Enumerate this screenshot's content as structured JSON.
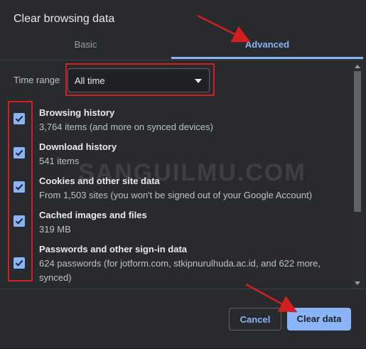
{
  "dialog": {
    "title": "Clear browsing data"
  },
  "tabs": [
    {
      "label": "Basic",
      "active": false
    },
    {
      "label": "Advanced",
      "active": true
    }
  ],
  "time_range": {
    "label": "Time range",
    "value": "All time"
  },
  "items": [
    {
      "title": "Browsing history",
      "description": "3,764 items (and more on synced devices)",
      "checked": true
    },
    {
      "title": "Download history",
      "description": "541 items",
      "checked": true
    },
    {
      "title": "Cookies and other site data",
      "description": "From 1,503 sites (you won't be signed out of your Google Account)",
      "checked": true
    },
    {
      "title": "Cached images and files",
      "description": "319 MB",
      "checked": true
    },
    {
      "title": "Passwords and other sign-in data",
      "description": "624 passwords (for jotform.com, stkipnurulhuda.ac.id, and 622 more, synced)",
      "checked": true
    }
  ],
  "buttons": {
    "cancel": "Cancel",
    "clear": "Clear data"
  },
  "watermark": "SANGUILMU.COM",
  "colors": {
    "accent": "#8ab4f8",
    "background": "#292a2d",
    "annotation": "#d21f1f"
  }
}
